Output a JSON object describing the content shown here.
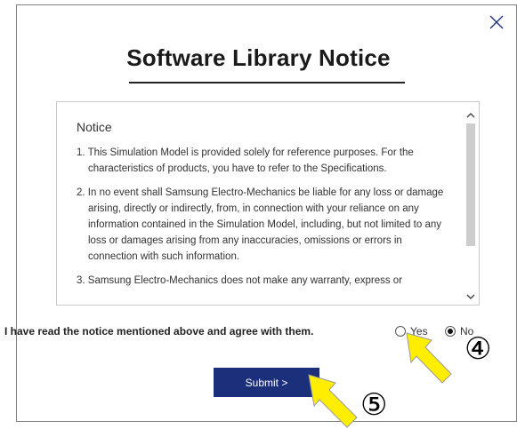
{
  "title": "Software Library Notice",
  "notice": {
    "heading": "Notice",
    "items": [
      "1. This Simulation Model is provided solely for reference purposes. For the characteristics of products, you have to refer to the Specifications.",
      "2. In no event shall Samsung Electro-Mechanics be liable for any loss or damage arising, directly or indirectly, from, in connection with your reliance on any information contained in the Simulation Model, including, but not limited to any loss or damages arising from any inaccuracies, omissions or errors in connection with such information.",
      "3. Samsung Electro-Mechanics does not make any warranty, express or"
    ]
  },
  "agreement": {
    "text": "I have read the notice mentioned above and agree with them.",
    "options": [
      {
        "label": "Yes",
        "selected": false
      },
      {
        "label": "No",
        "selected": true
      }
    ]
  },
  "submit_label": "Submit >",
  "annotations": {
    "step_4": "④",
    "step_5": "⑤",
    "arrow_color": "#ffee00"
  },
  "colors": {
    "submit_bg": "#1b2f7a",
    "close_icon": "#1b2f7a"
  }
}
